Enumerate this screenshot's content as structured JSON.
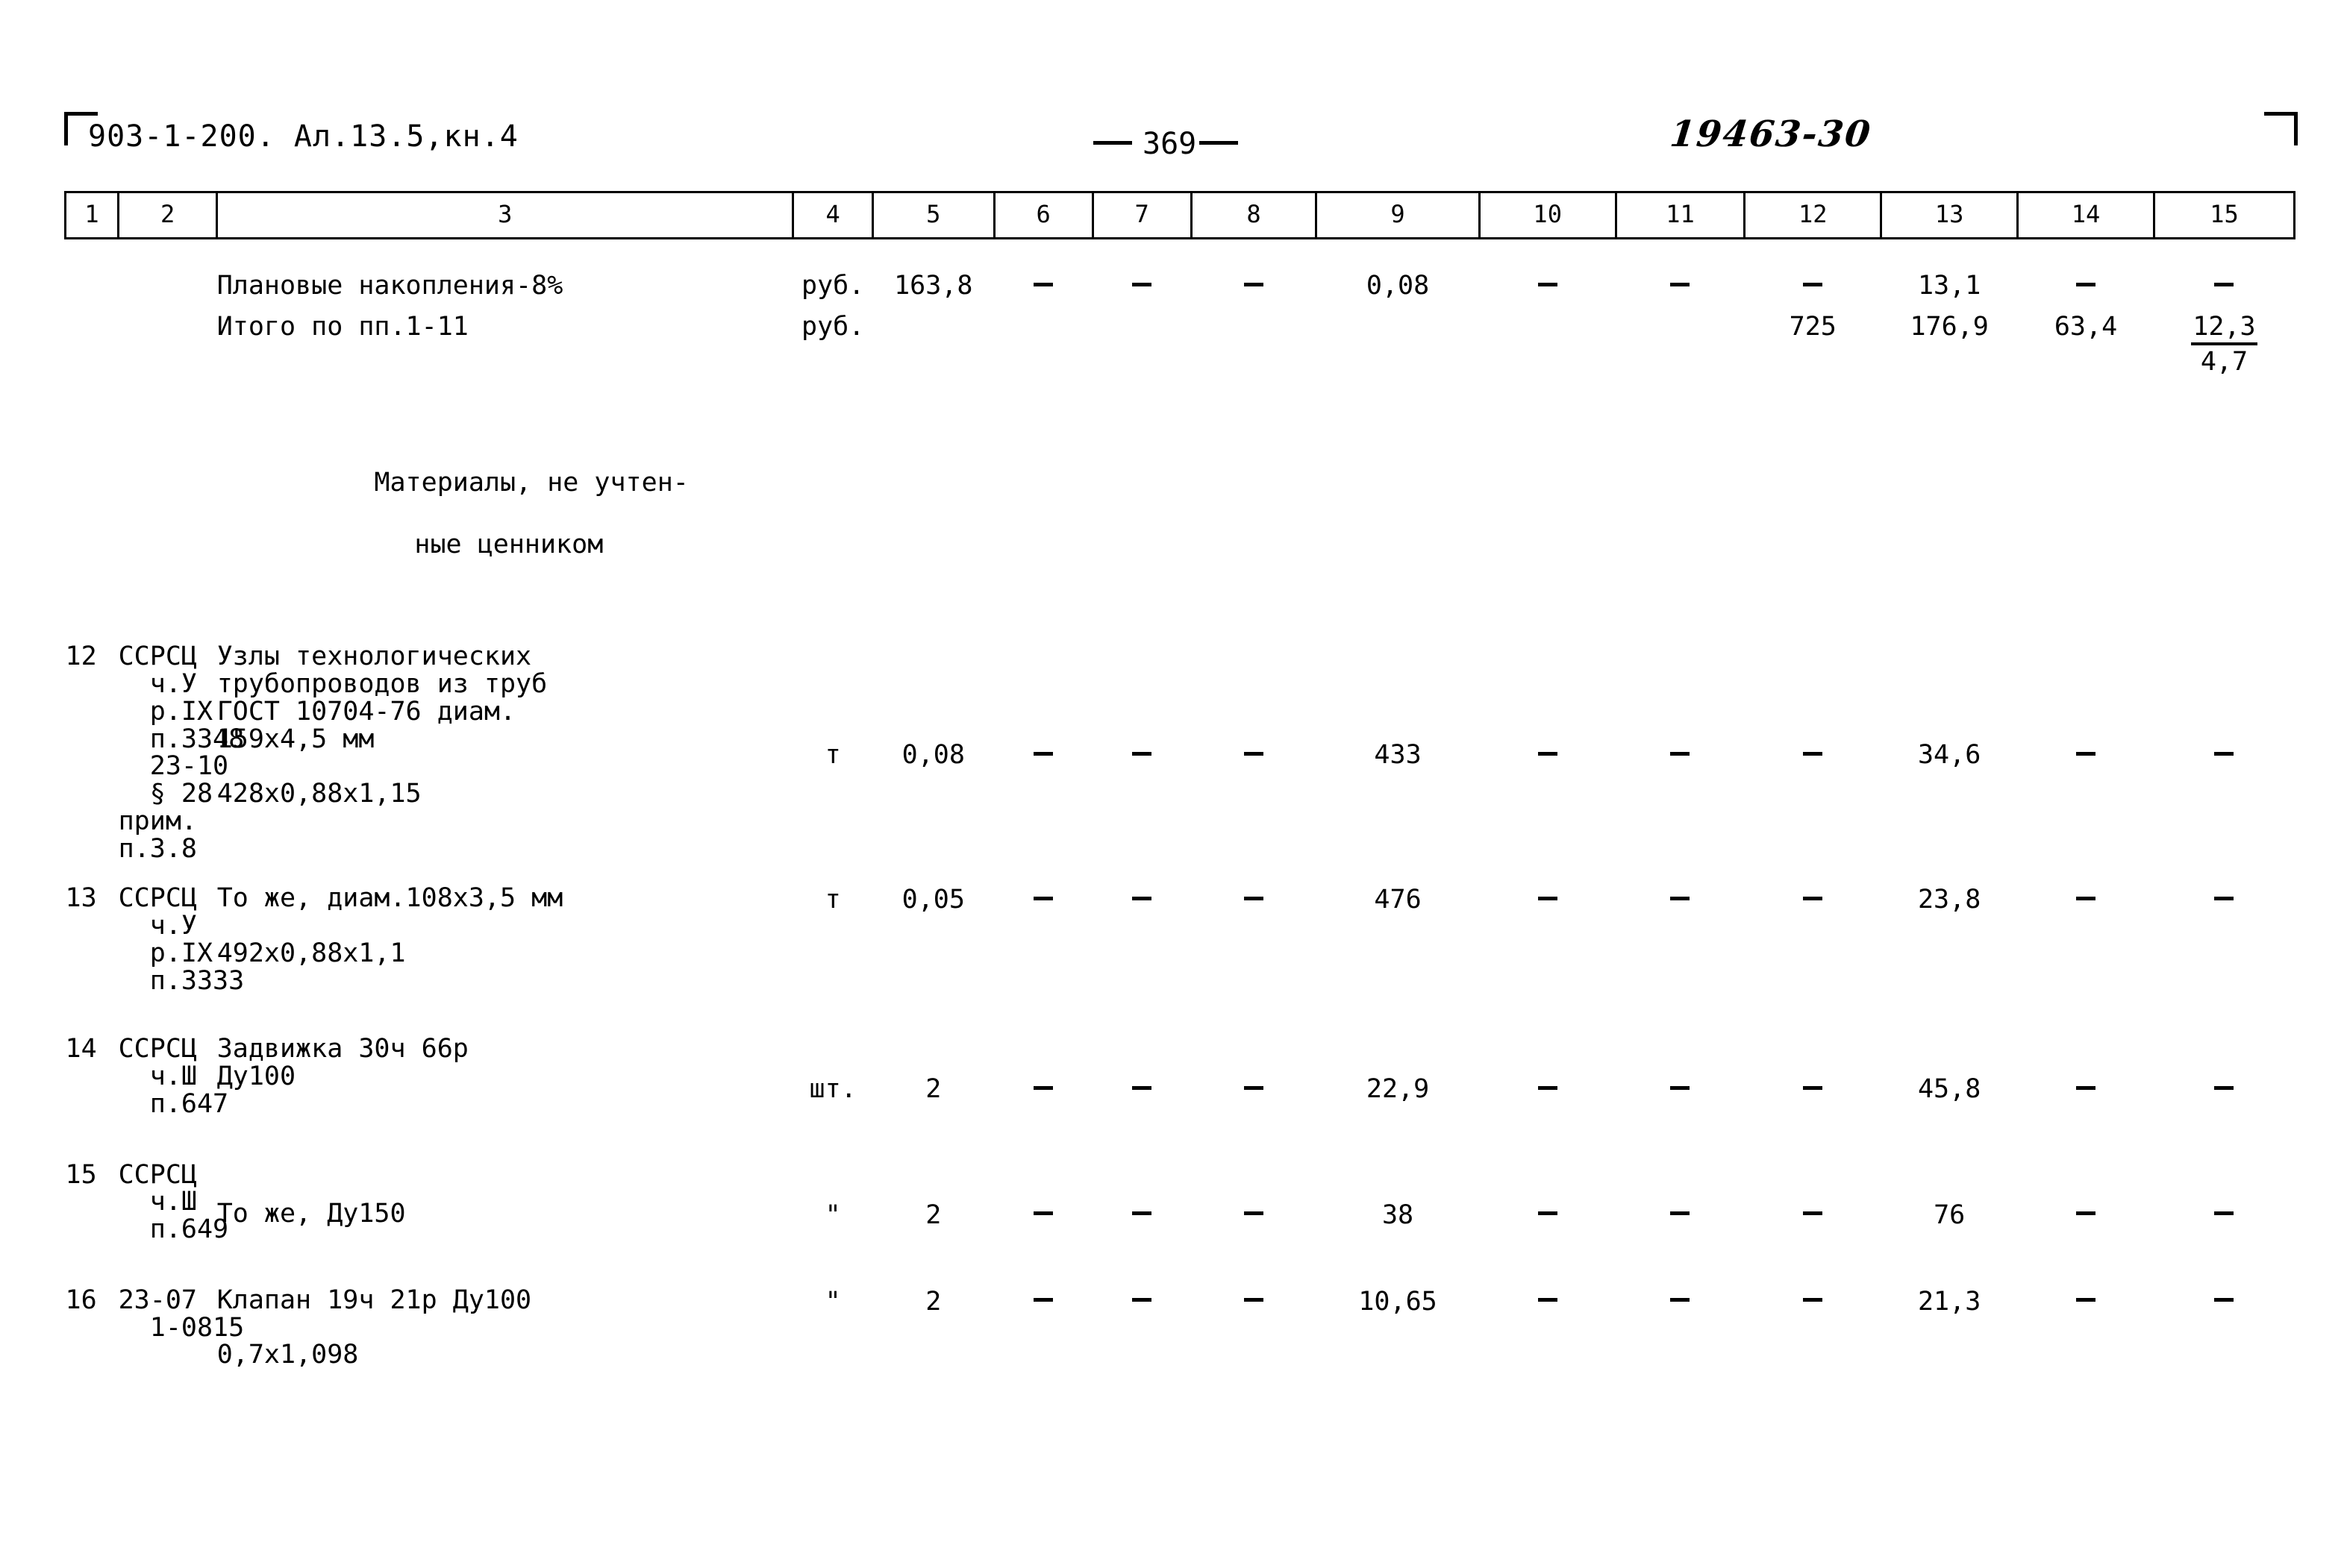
{
  "header": {
    "doc_code": "903-1-200. Ал.13.5,кн.4",
    "page_number": "369",
    "hand_note": "19463-30"
  },
  "table": {
    "column_headers": [
      "1",
      "2",
      "3",
      "4",
      "5",
      "6",
      "7",
      "8",
      "9",
      "10",
      "11",
      "12",
      "13",
      "14",
      "15"
    ],
    "rows": [
      {
        "kind": "data",
        "num": "",
        "code": "",
        "desc": "Плановые накопления-8%",
        "unit": "руб.",
        "c5": "163,8",
        "c6": "-",
        "c7": "-",
        "c8": "-",
        "c9": "0,08",
        "c10": "-",
        "c11": "-",
        "c12": "-",
        "c13": "13,1",
        "c14": "-",
        "c15": "-"
      },
      {
        "kind": "total",
        "num": "",
        "code": "",
        "desc": "Итого по пп.1-11",
        "unit": "руб.",
        "c5": "",
        "c6": "",
        "c7": "",
        "c8": "",
        "c9": "",
        "c10": "",
        "c11": "",
        "c12": "725",
        "c13": "176,9",
        "c14": "63,4",
        "c15_top": "12,3",
        "c15_bottom": "4,7"
      },
      {
        "kind": "heading",
        "desc_line1": "Материалы, не учтен-",
        "desc_line2": "ные ценником"
      },
      {
        "kind": "data",
        "num": "12",
        "code": "ССРСЦ\n  ч.У\n  р.IX\n  п.3348\n  23-10\n  § 28\nприм.\nп.3.8",
        "desc": "Узлы технологических\nтрубопроводов из труб\nГОСТ 10704-76 диам.\n159х4,5 мм\n\n428х0,88х1,15",
        "unit": "т",
        "c5": "0,08",
        "c6": "-",
        "c7": "-",
        "c8": "-",
        "c9": "433",
        "c10": "-",
        "c11": "-",
        "c12": "-",
        "c13": "34,6",
        "c14": "-",
        "c15": "-"
      },
      {
        "kind": "data",
        "num": "13",
        "code": "ССРСЦ\n  ч.У\n  р.IX\n  п.3333",
        "desc": "То же, диам.108х3,5 мм\n\n492х0,88х1,1",
        "unit": "т",
        "c5": "0,05",
        "c6": "-",
        "c7": "-",
        "c8": "-",
        "c9": "476",
        "c10": "-",
        "c11": "-",
        "c12": "-",
        "c13": "23,8",
        "c14": "-",
        "c15": "-"
      },
      {
        "kind": "data",
        "num": "14",
        "code": "ССРСЦ\n  ч.Ш\n  п.647",
        "desc": "Задвижка 30ч 66р\nДу100",
        "unit": "шт.",
        "c5": "2",
        "c6": "-",
        "c7": "-",
        "c8": "-",
        "c9": "22,9",
        "c10": "-",
        "c11": "-",
        "c12": "-",
        "c13": "45,8",
        "c14": "-",
        "c15": "-"
      },
      {
        "kind": "data",
        "num": "15",
        "code": "ССРСЦ\n  ч.Ш\n  п.649",
        "desc": "То же, Ду150",
        "unit": "\"",
        "c5": "2",
        "c6": "-",
        "c7": "-",
        "c8": "-",
        "c9": "38",
        "c10": "-",
        "c11": "-",
        "c12": "-",
        "c13": "76",
        "c14": "-",
        "c15": "-"
      },
      {
        "kind": "data",
        "num": "16",
        "code": "23-07\n  1-0815",
        "desc": "Клапан 19ч 21р Ду100\n\n0,7х1,098",
        "unit": "\"",
        "c5": "2",
        "c6": "-",
        "c7": "-",
        "c8": "-",
        "c9": "10,65",
        "c10": "-",
        "c11": "-",
        "c12": "-",
        "c13": "21,3",
        "c14": "-",
        "c15": "-"
      }
    ]
  }
}
